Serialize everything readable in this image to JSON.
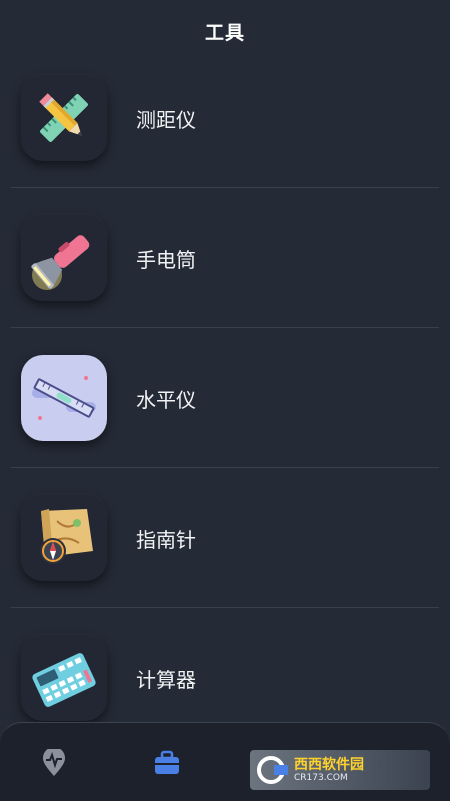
{
  "header": {
    "title": "工具"
  },
  "tools": [
    {
      "label": "测距仪",
      "icon": "ruler-pencil-icon"
    },
    {
      "label": "手电筒",
      "icon": "flashlight-icon"
    },
    {
      "label": "水平仪",
      "icon": "spirit-level-icon"
    },
    {
      "label": "指南针",
      "icon": "compass-map-icon"
    },
    {
      "label": "计算器",
      "icon": "calculator-icon"
    }
  ],
  "bottom_nav": {
    "items": [
      {
        "icon": "health-map-pin-icon",
        "active": false
      },
      {
        "icon": "toolbox-icon",
        "active": true
      }
    ],
    "active_color": "#4a7fe6"
  },
  "watermark": {
    "text": "西西软件园",
    "sub": "CR173.COM"
  }
}
